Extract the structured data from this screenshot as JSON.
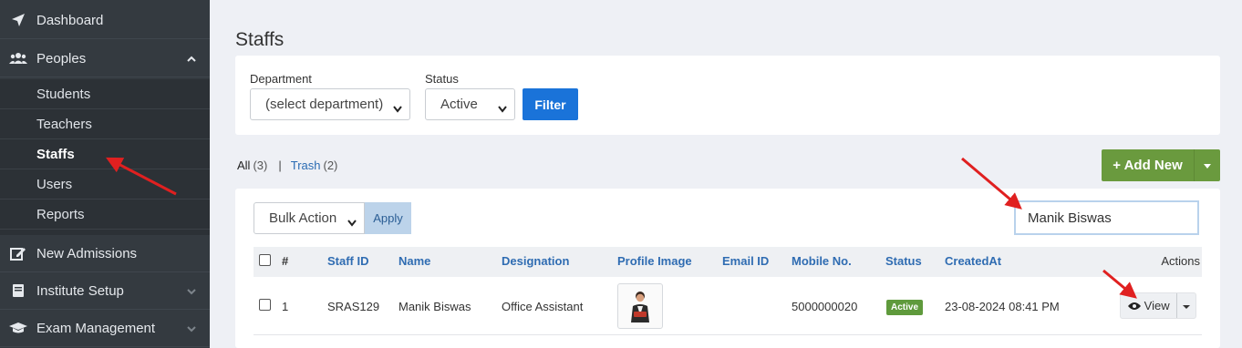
{
  "sidebar": {
    "items": [
      {
        "label": "Dashboard",
        "icon": "paper-plane-icon"
      },
      {
        "label": "Peoples",
        "icon": "users-icon"
      },
      {
        "label": "New Admissions",
        "icon": "edit-icon"
      },
      {
        "label": "Institute Setup",
        "icon": "book-icon"
      },
      {
        "label": "Exam Management",
        "icon": "graduation-cap-icon"
      }
    ],
    "peoples_sub": [
      "Students",
      "Teachers",
      "Staffs",
      "Users",
      "Reports"
    ],
    "active_sub": "Staffs"
  },
  "page": {
    "title": "Staffs"
  },
  "filter": {
    "department_label": "Department",
    "department_value": "(select department)",
    "status_label": "Status",
    "status_value": "Active",
    "filter_button": "Filter"
  },
  "tabs": {
    "all_label": "All",
    "all_count": "(3)",
    "separator": "|",
    "trash_label": "Trash",
    "trash_count": "(2)"
  },
  "add_new_button": "+ Add New",
  "toolbar": {
    "bulk_action": "Bulk Action",
    "apply": "Apply",
    "search_value": "Manik Biswas"
  },
  "table": {
    "headers": [
      "#",
      "Staff ID",
      "Name",
      "Designation",
      "Profile Image",
      "Email ID",
      "Mobile No.",
      "Status",
      "CreatedAt",
      "Actions"
    ],
    "rows": [
      {
        "index": "1",
        "staff_id": "SRAS129",
        "name": "Manik Biswas",
        "designation": "Office Assistant",
        "email": "",
        "mobile": "5000000020",
        "status": "Active",
        "created_at": "23-08-2024 08:41 PM",
        "action": "View"
      }
    ]
  },
  "colors": {
    "sidebar_bg": "#343a40",
    "primary": "#1a73d9",
    "success": "#6a9a3e",
    "annotation_arrow": "#e02020"
  }
}
